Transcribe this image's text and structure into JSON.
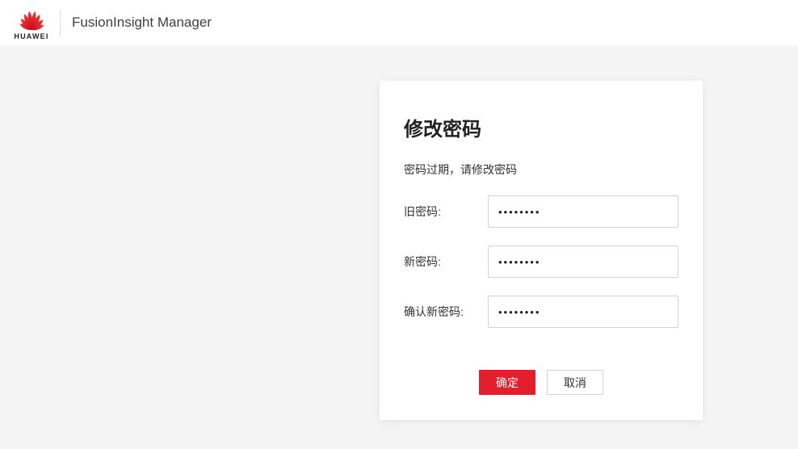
{
  "header": {
    "brand": "HUAWEI",
    "product": "FusionInsight Manager"
  },
  "colors": {
    "accent_red": "#e31e2d",
    "logo_red": "#e60012",
    "page_background": "#f4f4f5"
  },
  "dialog": {
    "title": "修改密码",
    "subtitle": "密码过期，请修改密码",
    "fields": [
      {
        "label": "旧密码:",
        "value": "••••••••"
      },
      {
        "label": "新密码:",
        "value": "••••••••"
      },
      {
        "label": "确认新密码:",
        "value": "••••••••"
      }
    ],
    "ok_label": "确定",
    "cancel_label": "取消"
  }
}
